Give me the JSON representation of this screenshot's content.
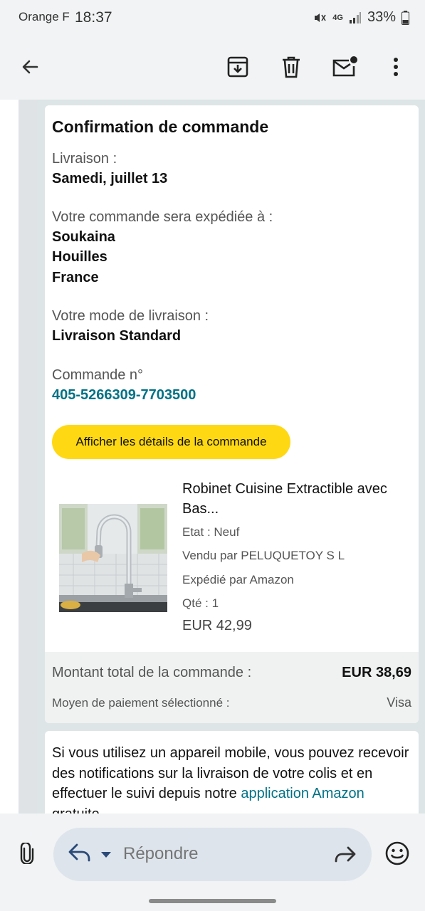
{
  "status_bar": {
    "carrier": "Orange F",
    "time": "18:37",
    "network": "4G",
    "battery": "33%",
    "icons": [
      "mute-icon",
      "signal-icon",
      "battery-icon"
    ]
  },
  "toolbar": {
    "icons": [
      "back-arrow-icon",
      "archive-icon",
      "delete-icon",
      "mark-unread-icon",
      "more-options-icon"
    ]
  },
  "email": {
    "title": "Confirmation de commande",
    "delivery_label": "Livraison :",
    "delivery_date": "Samedi, juillet 13",
    "ship_to_label": "Votre commande sera expédiée à :",
    "ship_to_name": "Soukaina",
    "ship_to_city": "Houilles",
    "ship_to_country": "France",
    "shipping_mode_label": "Votre mode de livraison :",
    "shipping_mode": "Livraison Standard",
    "order_number_label": "Commande n°",
    "order_number": "405-5266309-7703500",
    "details_button": "Afficher les détails de la commande",
    "product": {
      "title": "Robinet Cuisine Extractible avec Bas...",
      "condition": "Etat : Neuf",
      "seller": "Vendu par PELUQUETOY S L",
      "shipper": "Expédié par Amazon",
      "quantity": "Qté : 1",
      "price": "EUR 42,99"
    },
    "total_label": "Montant total de la commande :",
    "total_value": "EUR 38,69",
    "payment_label": "Moyen de paiement sélectionné :",
    "payment_value": "Visa",
    "notice_text": "Si vous utilisez un appareil mobile, vous pouvez recevoir des notifications sur la livraison de votre colis et en effectuer le suivi depuis notre ",
    "notice_link": "application Amazon",
    "notice_tail": " gratuite."
  },
  "reply_bar": {
    "placeholder": "Répondre",
    "icons": [
      "attachment-icon",
      "reply-icon",
      "reply-options-caret-icon",
      "forward-icon",
      "emoji-icon"
    ]
  },
  "colors": {
    "accent_link": "#007185",
    "button_yellow": "#ffd814",
    "reply_pill": "#dde4ec"
  }
}
